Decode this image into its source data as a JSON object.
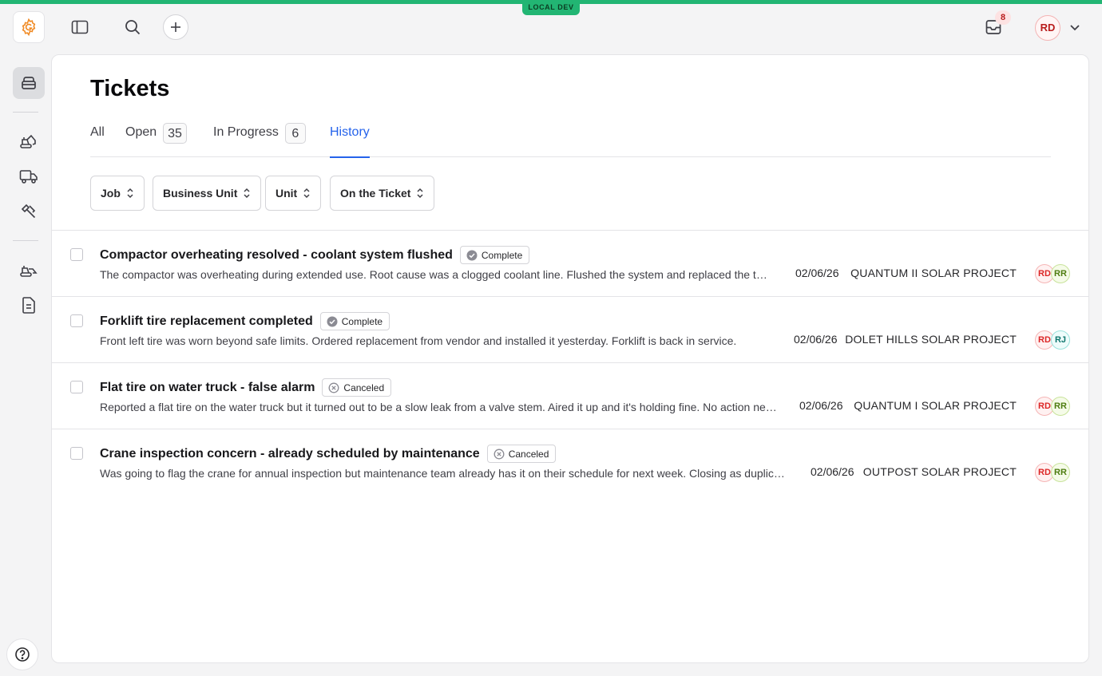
{
  "env": {
    "label": "LOCAL DEV",
    "color": "#22b573"
  },
  "topbar": {
    "inbox_count": "8",
    "user_initials": "RD"
  },
  "page": {
    "title": "Tickets",
    "tabs": [
      {
        "label": "All",
        "count": null,
        "active": false
      },
      {
        "label": "Open",
        "count": "35",
        "active": false
      },
      {
        "label": "In Progress",
        "count": "6",
        "active": false
      },
      {
        "label": "History",
        "count": null,
        "active": true
      }
    ],
    "filters": [
      {
        "label": "Job"
      },
      {
        "label": "Business Unit"
      },
      {
        "label": "Unit"
      },
      {
        "label": "On the Ticket"
      }
    ]
  },
  "tickets": [
    {
      "title": "Compactor overheating resolved - coolant system flushed",
      "status": "Complete",
      "description": "The compactor was overheating during extended use. Root cause was a clogged coolant line. Flushed the system and replaced the thermostat. Running normally now.",
      "date": "02/06/26",
      "project": "QUANTUM II SOLAR PROJECT",
      "assignees": [
        "RD",
        "RR"
      ]
    },
    {
      "title": "Forklift tire replacement completed",
      "status": "Complete",
      "description": "Front left tire was worn beyond safe limits. Ordered replacement from vendor and installed it yesterday. Forklift is back in service.",
      "date": "02/06/26",
      "project": "DOLET HILLS SOLAR PROJECT",
      "assignees": [
        "RD",
        "RJ"
      ]
    },
    {
      "title": "Flat tire on water truck - false alarm",
      "status": "Canceled",
      "description": "Reported a flat tire on the water truck but it turned out to be a slow leak from a valve stem. Aired it up and it's holding fine. No action needed.",
      "date": "02/06/26",
      "project": "QUANTUM I SOLAR PROJECT",
      "assignees": [
        "RD",
        "RR"
      ]
    },
    {
      "title": "Crane inspection concern - already scheduled by maintenance",
      "status": "Canceled",
      "description": "Was going to flag the crane for annual inspection but maintenance team already has it on their schedule for next week. Closing as duplicate.",
      "date": "02/06/26",
      "project": "OUTPOST SOLAR PROJECT",
      "assignees": [
        "RD",
        "RR"
      ]
    }
  ]
}
